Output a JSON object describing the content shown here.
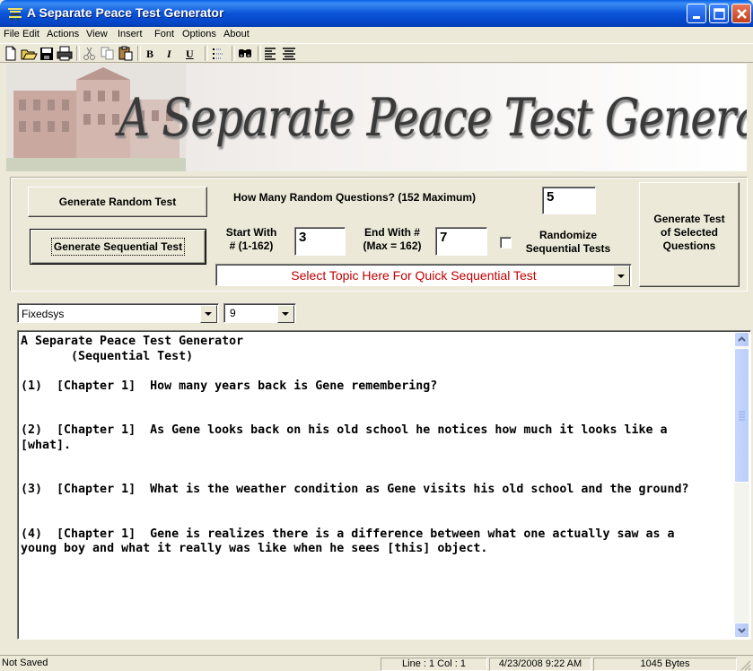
{
  "window": {
    "title": "A Separate Peace Test Generator",
    "app_icon": "app-pagoda-icon",
    "minimize_icon": "minimize-icon",
    "maximize_icon": "maximize-icon",
    "close_icon": "close-icon"
  },
  "menu": {
    "items": [
      "File",
      "Edit",
      "Actions",
      "View",
      "Insert",
      "Font",
      "Options",
      "About"
    ]
  },
  "toolbar": {
    "icons": [
      "new-document-icon",
      "open-folder-icon",
      "save-icon",
      "print-icon",
      "cut-icon",
      "copy-icon",
      "paste-icon",
      "bold-icon",
      "italic-icon",
      "underline-icon",
      "bullets-icon",
      "find-icon",
      "align-left-icon",
      "align-center-icon"
    ],
    "bold": "B",
    "italic": "I",
    "underline": "U"
  },
  "banner": {
    "text": "A Separate Peace Test Generator"
  },
  "controls": {
    "generate_random_label": "Generate Random Test",
    "how_many_label": "How Many Random Questions? (152 Maximum)",
    "how_many_value": "5",
    "generate_sequential_label": "Generate Sequential Test",
    "start_with_line1": "Start With",
    "start_with_line2": "# (1-162)",
    "start_with_value": "3",
    "end_with_line1": "End With #",
    "end_with_line2": "(Max = 162)",
    "end_with_value": "7",
    "randomize_line1": "Randomize",
    "randomize_line2": "Sequential Tests",
    "randomize_checked": false,
    "topic_select": "Select Topic Here For Quick Sequential Test",
    "generate_selected_line1": "Generate Test",
    "generate_selected_line2": "of Selected",
    "generate_selected_line3": "Questions"
  },
  "format": {
    "font_name": "Fixedsys",
    "font_size": "9"
  },
  "editor": {
    "content": "A Separate Peace Test Generator\n       (Sequential Test)\n\n(1)  [Chapter 1]  How many years back is Gene remembering?\n\n\n(2)  [Chapter 1]  As Gene looks back on his old school he notices how much it looks like a [what].\n\n\n(3)  [Chapter 1]  What is the weather condition as Gene visits his old school and the ground?\n\n\n(4)  [Chapter 1]  Gene is realizes there is a difference between what one actually saw as a young boy and what it really was like when he sees [this] object."
  },
  "status": {
    "saved": "Not Saved",
    "position": "Line : 1   Col : 1",
    "datetime": "4/23/2008  9:22 AM",
    "size": "1045 Bytes"
  },
  "colors": {
    "titlebar": "#0a54d8",
    "topic_text": "#c00000",
    "window_bg": "#ece9d8"
  }
}
